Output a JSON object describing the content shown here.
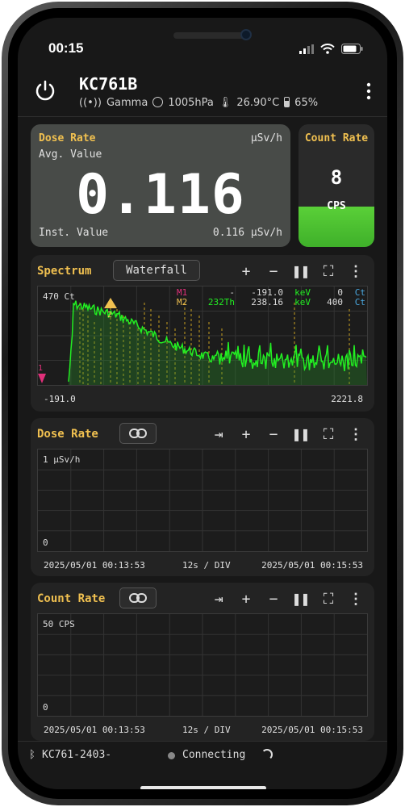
{
  "status": {
    "time": "00:15"
  },
  "header": {
    "title": "KC761B",
    "mode": "Gamma",
    "pressure": "1005hPa",
    "temperature": "26.90°C",
    "battery": "65%"
  },
  "dose_card": {
    "title": "Dose Rate",
    "unit": "μSv/h",
    "avg_label": "Avg. Value",
    "value": "0.116",
    "inst_label": "Inst. Value",
    "inst_value": "0.116 μSv/h"
  },
  "count_card": {
    "title": "Count Rate",
    "value": "8",
    "unit": "CPS",
    "level": 0.33
  },
  "spectrum": {
    "title": "Spectrum",
    "waterfall_label": "Waterfall",
    "y_label": "470 Ct",
    "markers": {
      "m1": {
        "name": "M1",
        "iso": "-",
        "val": "-191.0",
        "unit": "keV",
        "count": "0",
        "cunit": "Ct"
      },
      "m2": {
        "name": "M2",
        "iso": "232Th",
        "val": "238.16",
        "unit": "keV",
        "count": "400",
        "cunit": "Ct"
      }
    },
    "marker1_tag": "1",
    "marker2_tag": "2",
    "x_min": "-191.0",
    "x_max": "2221.8"
  },
  "dose_chart": {
    "title": "Dose Rate",
    "y_top": "1 μSv/h",
    "y_zero": "0",
    "start": "2025/05/01 00:13:53",
    "div": "12s / DIV",
    "end": "2025/05/01 00:15:53"
  },
  "count_chart": {
    "title": "Count Rate",
    "y_top": "50 CPS",
    "y_zero": "0",
    "start": "2025/05/01 00:13:53",
    "div": "12s / DIV",
    "end": "2025/05/01 00:15:53"
  },
  "bottom": {
    "device": "KC761-2403-",
    "state": "Connecting"
  },
  "colors": {
    "accent": "#f0c050",
    "spectrum": "#22ee22",
    "count_fill": "#4cc830",
    "marker1": "#e0307a"
  }
}
